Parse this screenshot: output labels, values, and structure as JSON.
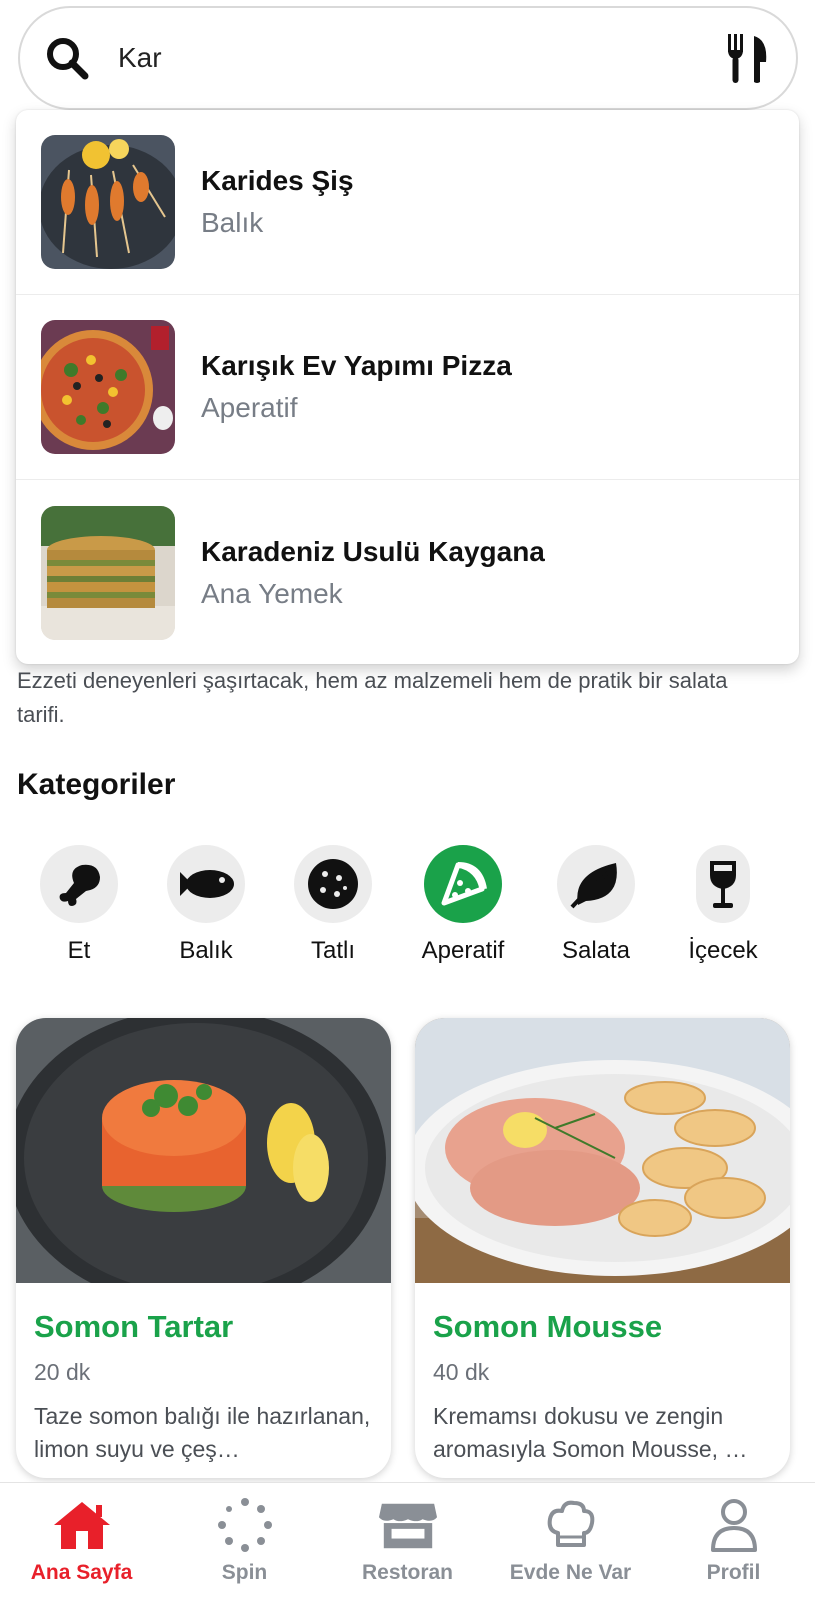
{
  "search": {
    "value": "Kar",
    "icon": "search-icon",
    "right_icon": "cutlery-icon"
  },
  "suggestions": [
    {
      "name": "Karides Şiş",
      "category": "Balık"
    },
    {
      "name": "Karışık Ev Yapımı Pizza",
      "category": "Aperatif"
    },
    {
      "name": "Karadeniz Usulü Kaygana",
      "category": "Ana Yemek"
    }
  ],
  "description": "Ezzeti deneyenleri şaşırtacak, hem az malzemeli hem de pratik bir salata tarifi.",
  "categories_title": "Kategoriler",
  "categories": [
    {
      "label": "Et",
      "icon": "meat-drumstick-icon",
      "active": false
    },
    {
      "label": "Balık",
      "icon": "fish-icon",
      "active": false
    },
    {
      "label": "Tatlı",
      "icon": "cookie-icon",
      "active": false
    },
    {
      "label": "Aperatif",
      "icon": "pizza-slice-icon",
      "active": true
    },
    {
      "label": "Salata",
      "icon": "leaf-icon",
      "active": false
    },
    {
      "label": "İçecek",
      "icon": "wine-glass-icon",
      "active": false
    }
  ],
  "recipes": [
    {
      "title": "Somon Tartar",
      "time": "20 dk",
      "description": "Taze somon balığı ile hazırlanan, limon suyu ve çeş…"
    },
    {
      "title": "Somon Mousse",
      "time": "40 dk",
      "description": "Kremamsı dokusu ve zengin aromasıyla Somon Mousse, …"
    }
  ],
  "nav": [
    {
      "label": "Ana Sayfa",
      "icon": "home-icon",
      "active": true
    },
    {
      "label": "Spin",
      "icon": "spinner-icon",
      "active": false
    },
    {
      "label": "Restoran",
      "icon": "store-icon",
      "active": false
    },
    {
      "label": "Evde Ne Var",
      "icon": "chef-hat-icon",
      "active": false
    },
    {
      "label": "Profil",
      "icon": "user-icon",
      "active": false
    }
  ],
  "colors": {
    "accent_green": "#1aa24a",
    "active_red": "#e8202a",
    "muted_gray": "#8a8f96"
  }
}
